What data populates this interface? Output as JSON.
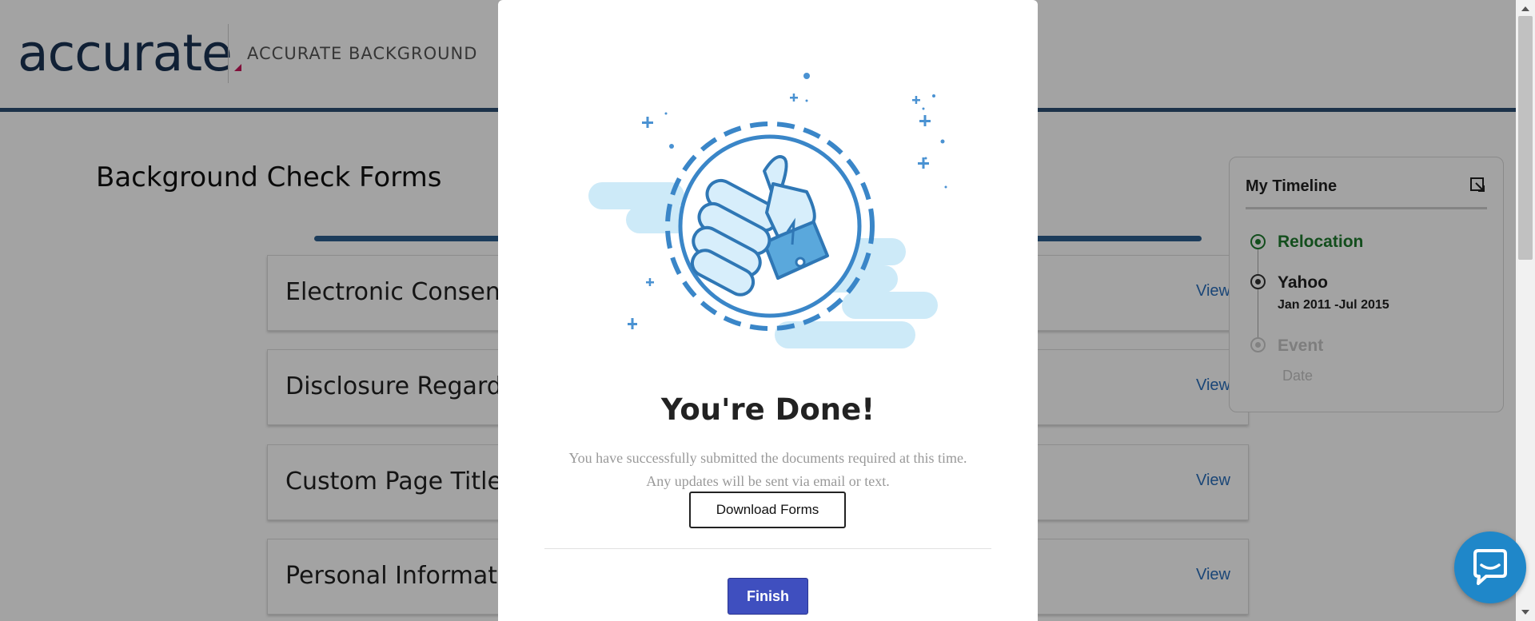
{
  "header": {
    "logo_text": "accurate",
    "company_name": "ACCURATE BACKGROUND"
  },
  "main": {
    "page_title": "Background Check Forms",
    "forms": [
      {
        "name": "Electronic Consent",
        "action": "View"
      },
      {
        "name": "Disclosure Regarding",
        "action": "View"
      },
      {
        "name": "Custom Page Title",
        "action": "View"
      },
      {
        "name": "Personal Information",
        "action": "View"
      }
    ]
  },
  "timeline": {
    "title": "My Timeline",
    "items": [
      {
        "name": "Relocation",
        "date": ""
      },
      {
        "name": "Yahoo",
        "date": "Jan 2011 -Jul 2015"
      },
      {
        "name": "Event",
        "date": "Date"
      }
    ]
  },
  "modal": {
    "title": "You're Done!",
    "message_line1": "You have successfully submitted the documents required at this time.",
    "message_line2": "Any updates will be sent via email or text.",
    "download_label": "Download Forms",
    "finish_label": "Finish"
  },
  "colors": {
    "brand_navy": "#1a3354",
    "accent_pink": "#c8175a",
    "link_blue": "#2a6ebb",
    "timeline_green": "#1f7a2e",
    "finish_blue": "#3f4fbf",
    "chat_blue": "#1f87c9"
  },
  "icons": [
    "thumbs-up-icon",
    "expand-icon",
    "chat-icon"
  ]
}
